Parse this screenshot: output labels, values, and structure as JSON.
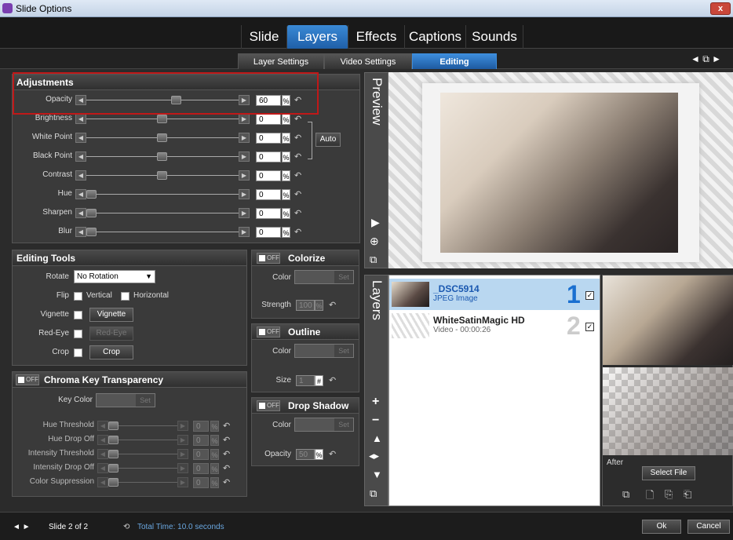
{
  "window": {
    "title": "Slide Options",
    "close": "x"
  },
  "tabs": [
    "Slide",
    "Layers",
    "Effects",
    "Captions",
    "Sounds"
  ],
  "active_tab": "Layers",
  "subtabs": [
    "Layer Settings",
    "Video Settings",
    "Editing"
  ],
  "active_subtab": "Editing",
  "adjustments": {
    "title": "Adjustments",
    "rows": [
      {
        "label": "Opacity",
        "value": "60",
        "unit": "%",
        "level": 0.6
      },
      {
        "label": "Brightness",
        "value": "0",
        "unit": "%",
        "level": 0.5
      },
      {
        "label": "White Point",
        "value": "0",
        "unit": "%",
        "level": 0.5
      },
      {
        "label": "Black Point",
        "value": "0",
        "unit": "%",
        "level": 0.5
      },
      {
        "label": "Contrast",
        "value": "0",
        "unit": "%",
        "level": 0.5
      },
      {
        "label": "Hue",
        "value": "0",
        "unit": "%",
        "level": 0.0
      },
      {
        "label": "Sharpen",
        "value": "0",
        "unit": "%",
        "level": 0.0
      },
      {
        "label": "Blur",
        "value": "0",
        "unit": "%",
        "level": 0.0
      }
    ],
    "auto_label": "Auto"
  },
  "editing_tools": {
    "title": "Editing Tools",
    "rotate_label": "Rotate",
    "rotate_value": "No Rotation",
    "flip_label": "Flip",
    "vertical_label": "Vertical",
    "horizontal_label": "Horizontal",
    "vignette_label": "Vignette",
    "vignette_button": "Vignette",
    "redeye_label": "Red-Eye",
    "redeye_button": "Red-Eye",
    "crop_label": "Crop",
    "crop_button": "Crop"
  },
  "chroma": {
    "title": "Chroma Key Transparency",
    "off": "OFF",
    "key_color_label": "Key Color",
    "set": "Set",
    "rows": [
      {
        "label": "Hue Threshold",
        "value": "0",
        "unit": "%"
      },
      {
        "label": "Hue Drop Off",
        "value": "0",
        "unit": "%"
      },
      {
        "label": "Intensity Threshold",
        "value": "0",
        "unit": "%"
      },
      {
        "label": "Intensity Drop Off",
        "value": "0",
        "unit": "%"
      },
      {
        "label": "Color Suppression",
        "value": "0",
        "unit": "%"
      }
    ]
  },
  "colorize": {
    "title": "Colorize",
    "off": "OFF",
    "color_label": "Color",
    "set": "Set",
    "strength_label": "Strength",
    "strength_value": "100",
    "unit": "%"
  },
  "outline": {
    "title": "Outline",
    "off": "OFF",
    "color_label": "Color",
    "set": "Set",
    "size_label": "Size",
    "size_value": "1",
    "unit": "#"
  },
  "drop_shadow": {
    "title": "Drop Shadow",
    "off": "OFF",
    "color_label": "Color",
    "set": "Set",
    "opacity_label": "Opacity",
    "opacity_value": "50",
    "unit": "%"
  },
  "preview": {
    "label": "Preview"
  },
  "layers_panel": {
    "label": "Layers",
    "items": [
      {
        "name": "_DSC5914",
        "type": "JPEG Image",
        "number": "1",
        "checked": true
      },
      {
        "name": "WhiteSatinMagic HD",
        "type": "Video - 00:00:26",
        "number": "2",
        "checked": true
      }
    ]
  },
  "side": {
    "after_label": "After",
    "select_file": "Select File"
  },
  "footer": {
    "slide_text": "Slide 2 of 2",
    "total_time": "Total Time: 10.0 seconds",
    "ok": "Ok",
    "cancel": "Cancel"
  }
}
